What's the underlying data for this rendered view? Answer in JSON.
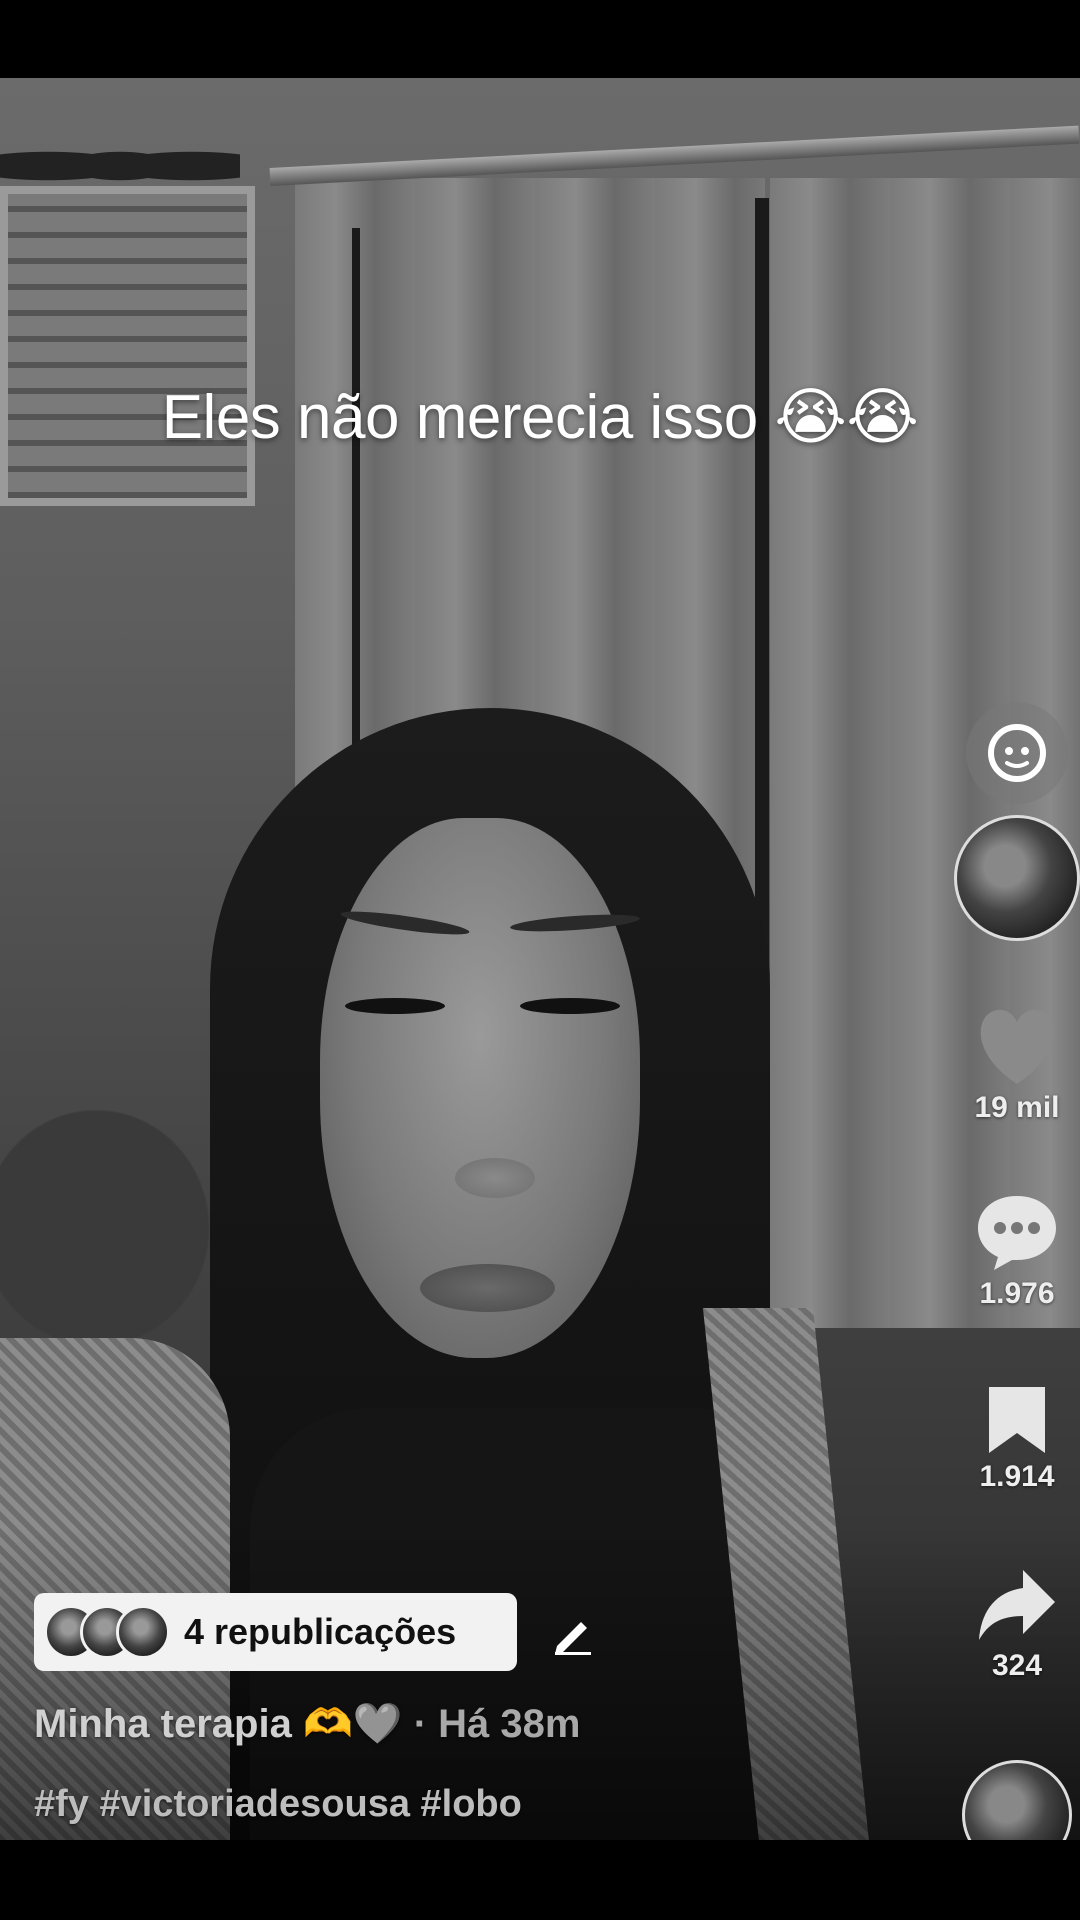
{
  "caption": "Eles não merecia isso 😭😭",
  "rail": {
    "likes": "19 mil",
    "comments": "1.976",
    "saves": "1.914",
    "shares": "324"
  },
  "repost": {
    "label": "4 republicações"
  },
  "post": {
    "title": "Minha terapia 🫶🩶",
    "time": "· Há 38m",
    "hashtags": "#fy #victoriadesousa #lobo"
  },
  "icons": {
    "gif": "gif-sticker-icon",
    "like": "heart-icon",
    "comment": "comment-bubble-icon",
    "save": "bookmark-icon",
    "share": "share-arrow-icon",
    "edit": "pencil-icon"
  }
}
